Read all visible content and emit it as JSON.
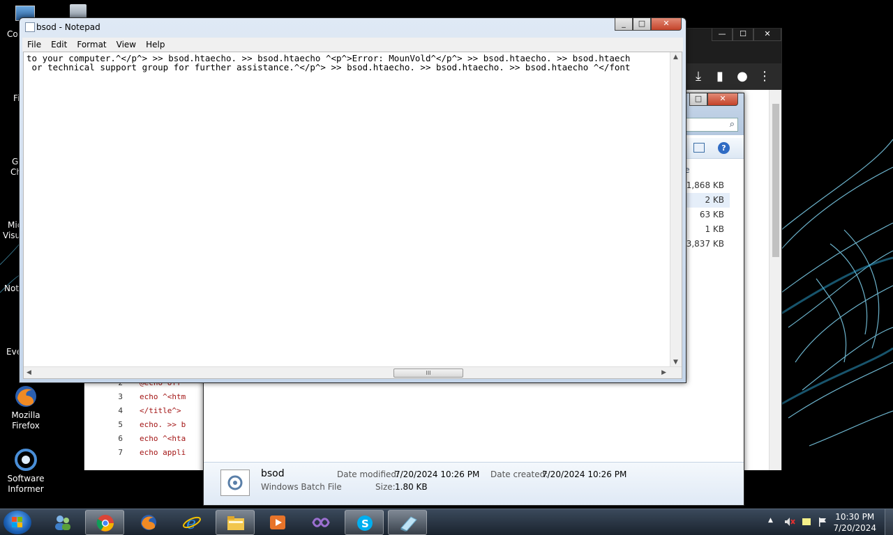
{
  "notepad": {
    "title": "bsod - Notepad",
    "menu": [
      "File",
      "Edit",
      "Format",
      "View",
      "Help"
    ],
    "lines": [
      "to your computer.^</p^> >> bsod.htaecho. >> bsod.htaecho ^<p^>Error: MounVold^</p^> >> bsod.htaecho. >> bsod.htaech",
      " or technical support group for further assistance.^</p^> >> bsod.htaecho. >> bsod.htaecho. >> bsod.htaecho ^</font"
    ],
    "scroll_thumb_glyph": "III"
  },
  "explorer": {
    "size_header": "Size",
    "sizes": [
      "1,868 KB",
      "2 KB",
      "63 KB",
      "1 KB",
      "3,837 KB"
    ],
    "details": {
      "name": "bsod",
      "type": "Windows Batch File",
      "date_modified_label": "Date modified:",
      "date_modified": "7/20/2024 10:26 PM",
      "date_created_label": "Date created:",
      "date_created": "7/20/2024 10:26 PM",
      "size_label": "Size:",
      "size": "1.80 KB"
    }
  },
  "editor": {
    "lines": [
      {
        "num": "2",
        "text": "@echo off"
      },
      {
        "num": "3",
        "text": "echo ^<htm"
      },
      {
        "num": "4",
        "text": "</title^>"
      },
      {
        "num": "5",
        "text": "echo. >> b"
      },
      {
        "num": "6",
        "text": "echo ^<hta"
      },
      {
        "num": "7",
        "text": "echo appli"
      }
    ]
  },
  "desktop": {
    "icons": {
      "firefox": "Mozilla Firefox",
      "software_informer": "Software Informer"
    },
    "partial_labels": [
      "Co",
      "Fi",
      "Go",
      "Chi",
      "Mic",
      "Visua",
      "Note",
      "Eve"
    ]
  },
  "taskbar": {
    "time": "10:30 PM",
    "date": "7/20/2024"
  },
  "colors": {
    "accent": "#1a5fb4",
    "close": "#c4432a"
  }
}
